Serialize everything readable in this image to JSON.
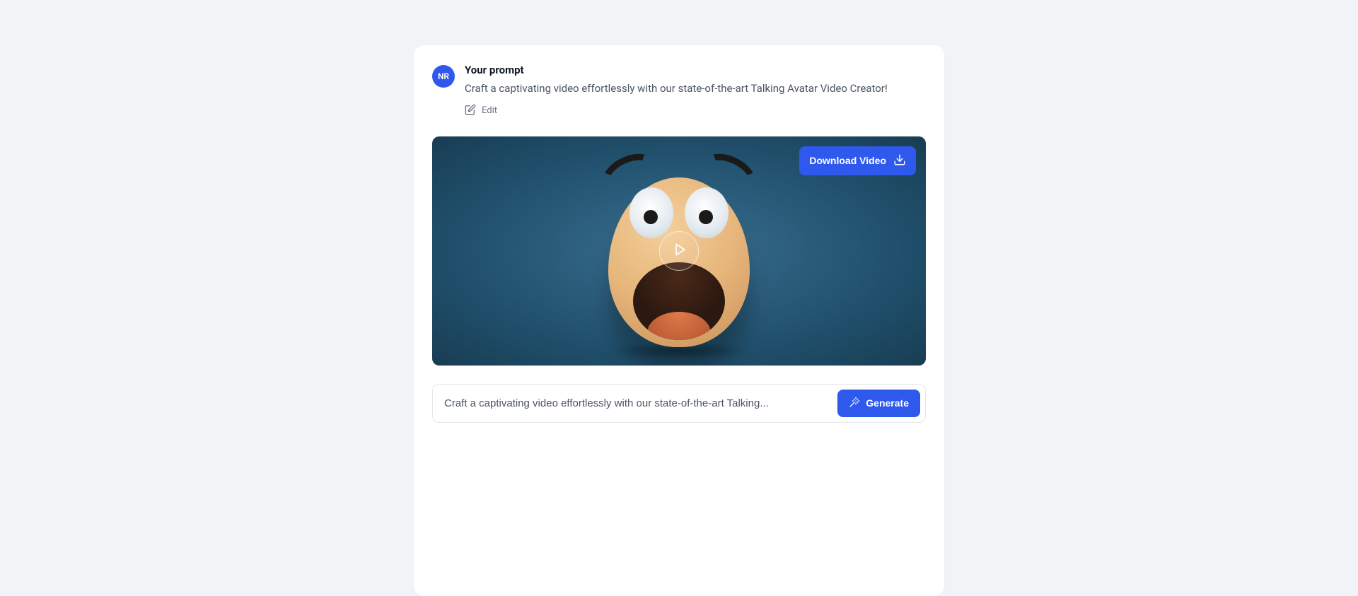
{
  "avatar_initials": "NR",
  "prompt": {
    "title": "Your prompt",
    "text": "Craft a captivating video effortlessly with our state-of-the-art Talking Avatar Video Creator!",
    "edit_label": "Edit"
  },
  "video": {
    "download_label": "Download Video"
  },
  "input": {
    "value": "Craft a captivating video effortlessly with our state-of-the-art Talking...",
    "generate_label": "Generate"
  }
}
